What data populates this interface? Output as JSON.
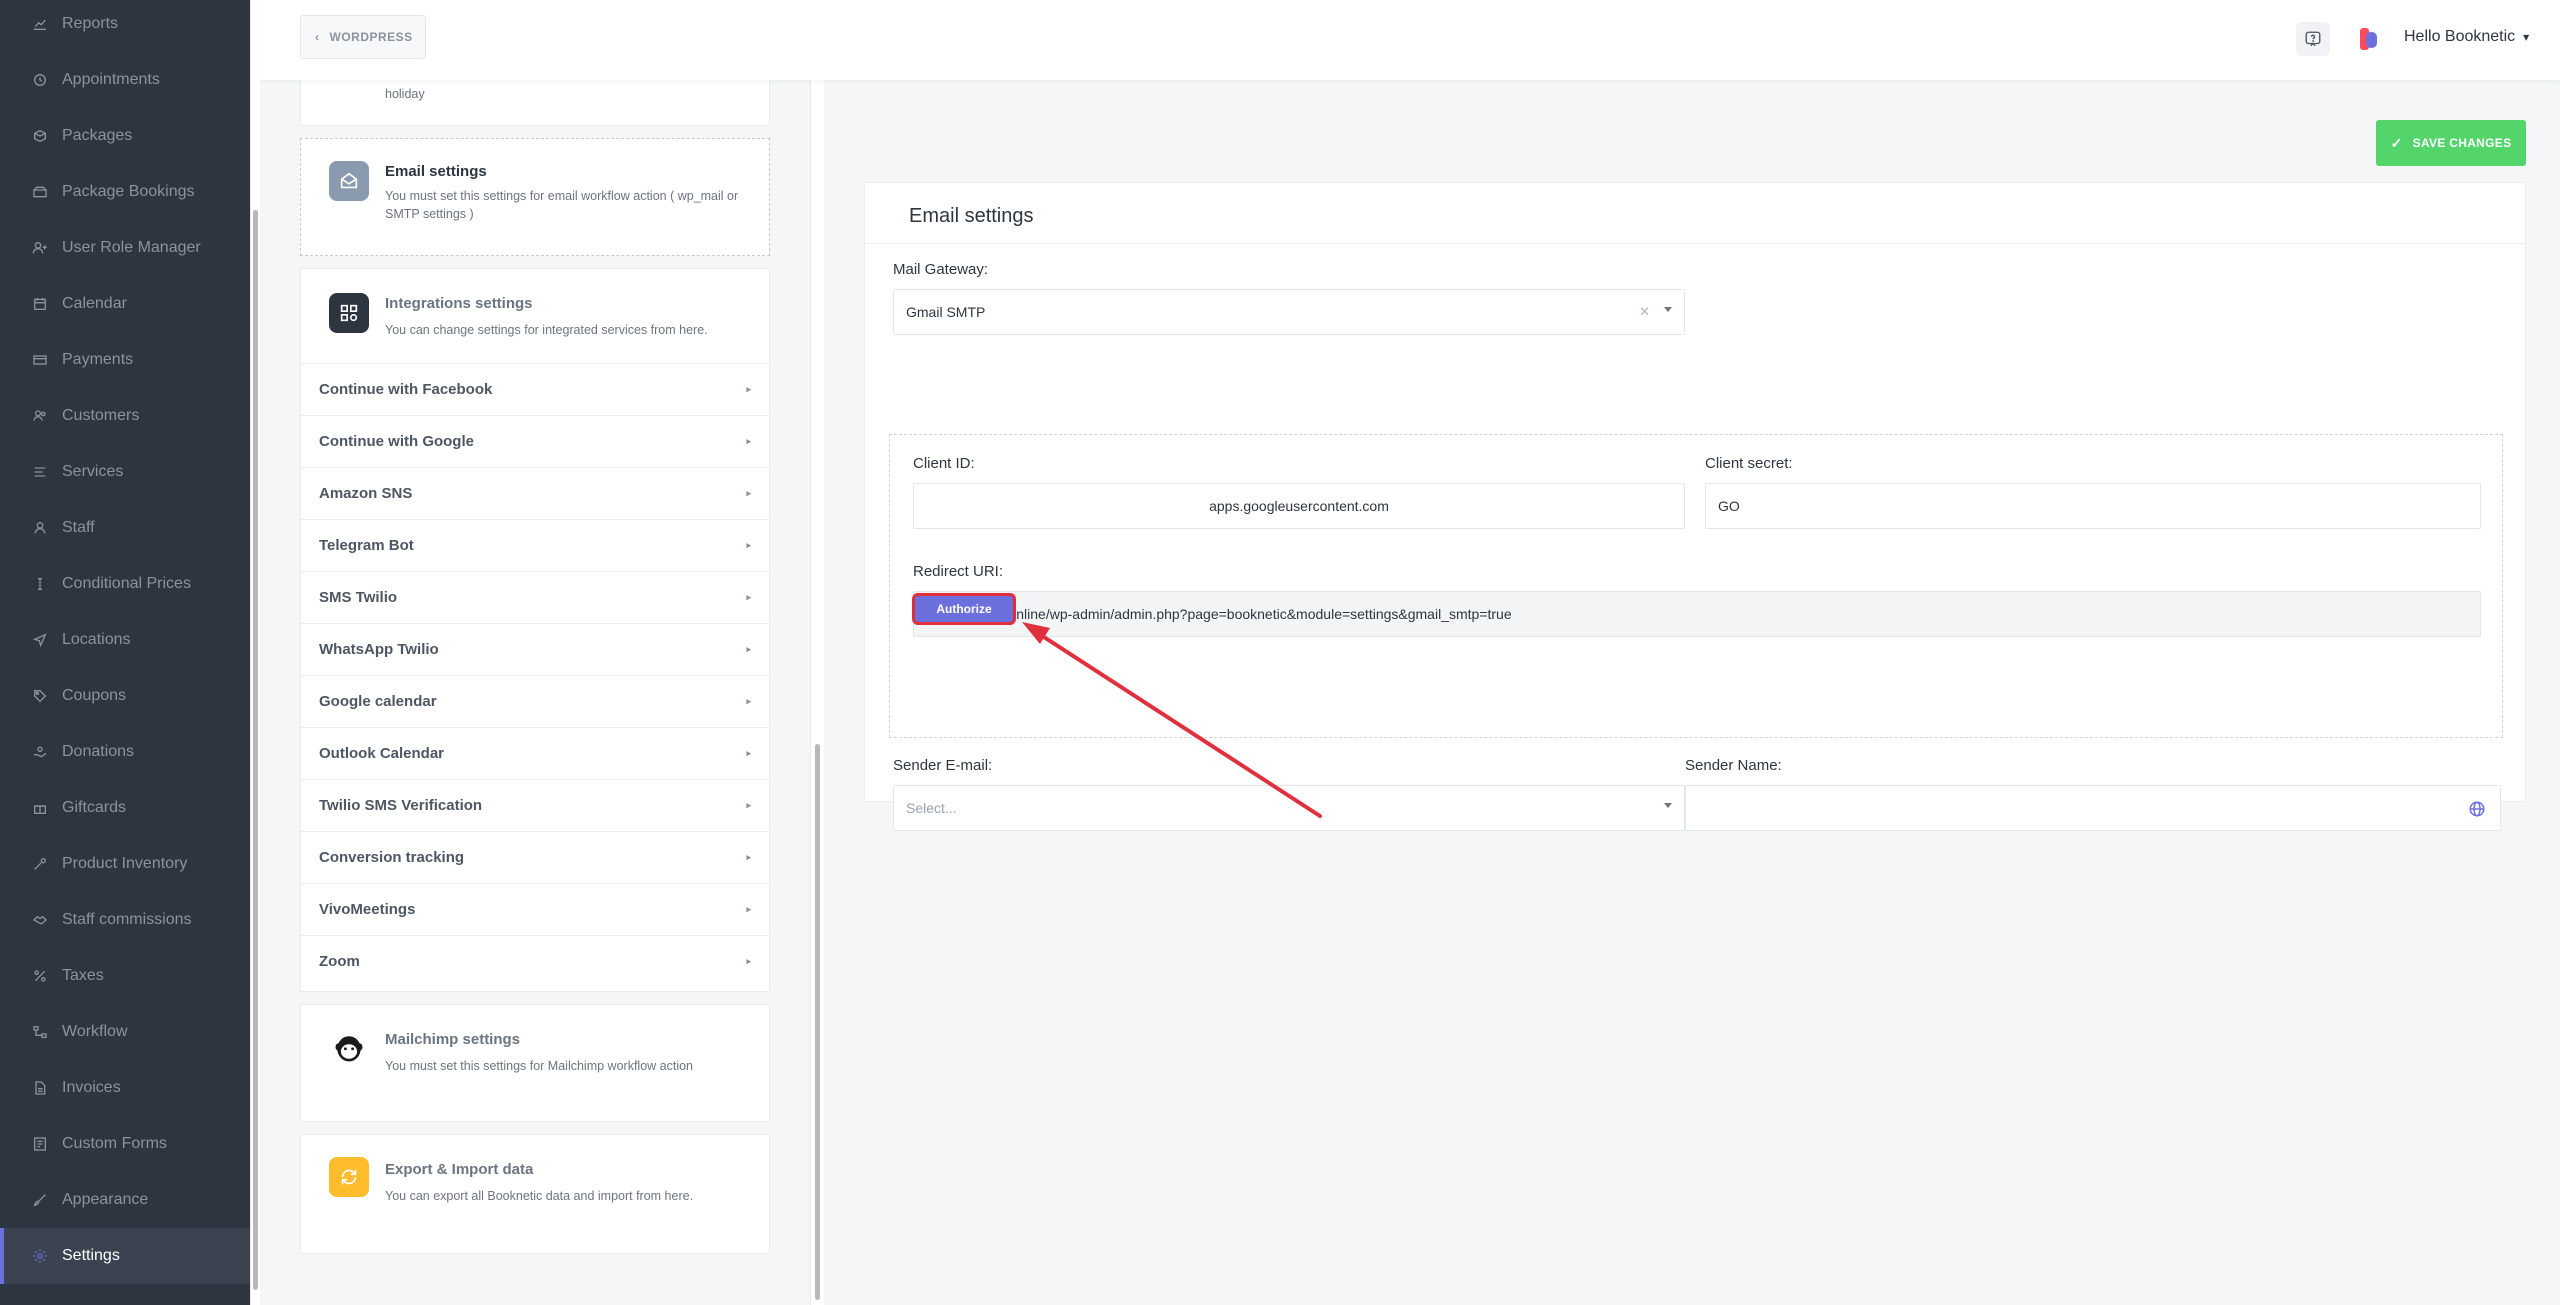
{
  "sidebar": {
    "items": [
      {
        "label": "Reports",
        "icon": "chart-line-icon"
      },
      {
        "label": "Appointments",
        "icon": "clock-icon"
      },
      {
        "label": "Packages",
        "icon": "package-icon"
      },
      {
        "label": "Package Bookings",
        "icon": "box-open-icon"
      },
      {
        "label": "User Role Manager",
        "icon": "user-plus-icon"
      },
      {
        "label": "Calendar",
        "icon": "calendar-icon"
      },
      {
        "label": "Payments",
        "icon": "credit-card-icon"
      },
      {
        "label": "Customers",
        "icon": "users-icon"
      },
      {
        "label": "Services",
        "icon": "list-icon"
      },
      {
        "label": "Staff",
        "icon": "user-icon"
      },
      {
        "label": "Conditional Prices",
        "icon": "cursor-text-icon"
      },
      {
        "label": "Locations",
        "icon": "location-arrow-icon"
      },
      {
        "label": "Coupons",
        "icon": "tag-icon"
      },
      {
        "label": "Donations",
        "icon": "hand-holding-icon"
      },
      {
        "label": "Giftcards",
        "icon": "gift-icon"
      },
      {
        "label": "Product Inventory",
        "icon": "tools-icon"
      },
      {
        "label": "Staff commissions",
        "icon": "handshake-icon"
      },
      {
        "label": "Taxes",
        "icon": "percent-icon"
      },
      {
        "label": "Workflow",
        "icon": "workflow-icon"
      },
      {
        "label": "Invoices",
        "icon": "file-icon"
      },
      {
        "label": "Custom Forms",
        "icon": "form-icon"
      },
      {
        "label": "Appearance",
        "icon": "brush-icon"
      },
      {
        "label": "Settings",
        "icon": "gear-icon",
        "active": true
      }
    ]
  },
  "header": {
    "back_label": "WORDPRESS",
    "user_label": "Hello Booknetic"
  },
  "settings_list": {
    "top_card_desc_tail": "holiday",
    "email": {
      "title": "Email settings",
      "desc": "You must set this settings for email workflow action ( wp_mail or SMTP settings )"
    },
    "integrations": {
      "title": "Integrations settings",
      "desc": "You can change settings for integrated services from here.",
      "items": [
        "Continue with Facebook",
        "Continue with Google",
        "Amazon SNS",
        "Telegram Bot",
        "SMS Twilio",
        "WhatsApp Twilio",
        "Google calendar",
        "Outlook Calendar",
        "Twilio SMS Verification",
        "Conversion tracking",
        "VivoMeetings",
        "Zoom"
      ]
    },
    "mailchimp": {
      "title": "Mailchimp settings",
      "desc": "You must set this settings for Mailchimp workflow action"
    },
    "export": {
      "title": "Export & Import data",
      "desc": "You can export all Booknetic data and import from here."
    }
  },
  "main": {
    "save_label": "SAVE CHANGES",
    "card_title": "Email settings",
    "mail_gateway_label": "Mail Gateway:",
    "mail_gateway_value": "Gmail SMTP",
    "client_id_label": "Client ID:",
    "client_id_value": "apps.googleusercontent.com",
    "client_secret_label": "Client secret:",
    "client_secret_value": "GO",
    "redirect_uri_label": "Redirect URI:",
    "redirect_uri_value": "https://isamir.online/wp-admin/admin.php?page=booknetic&module=settings&gmail_smtp=true",
    "authorize_label": "Authorize",
    "sender_email_label": "Sender E-mail:",
    "sender_email_placeholder": "Select...",
    "sender_name_label": "Sender Name:",
    "sender_name_value": ""
  },
  "colors": {
    "accent": "#6c70dc",
    "save_green": "#53d56c",
    "sidebar_bg": "#2d3540",
    "annotation_red": "#e0303d"
  }
}
